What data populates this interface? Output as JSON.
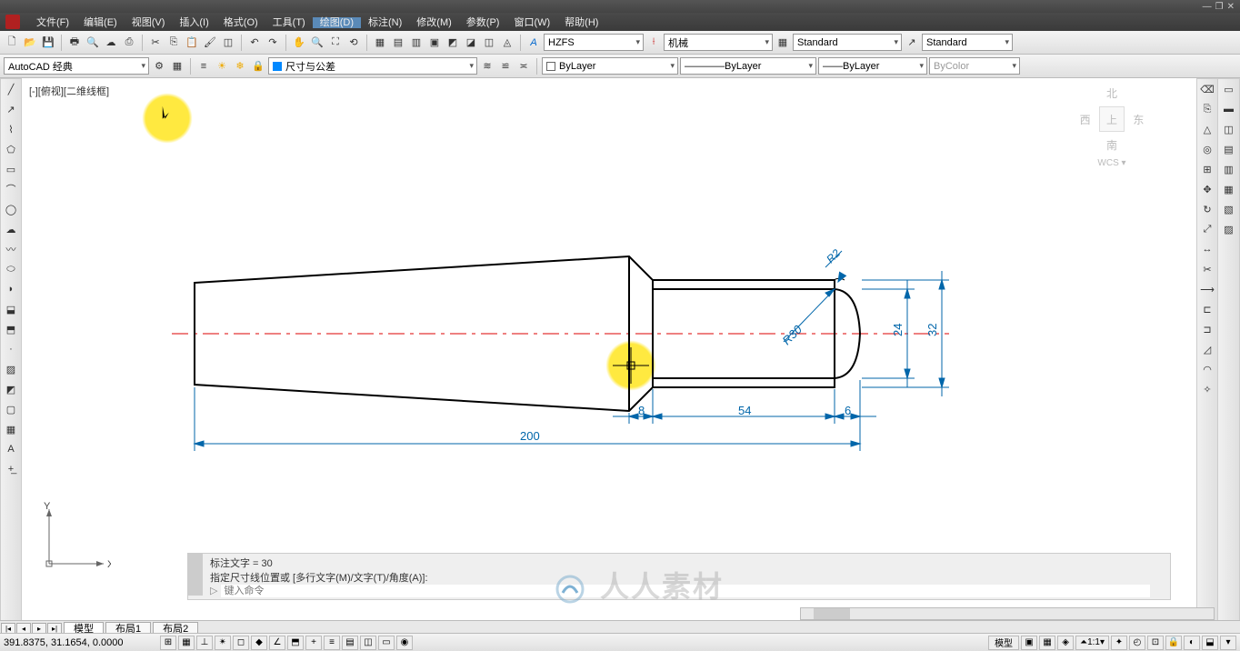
{
  "window": {
    "min": "—",
    "restore": "❐",
    "close": "✕"
  },
  "menu": [
    "文件(F)",
    "编辑(E)",
    "视图(V)",
    "插入(I)",
    "格式(O)",
    "工具(T)",
    "绘图(D)",
    "标注(N)",
    "修改(M)",
    "参数(P)",
    "窗口(W)",
    "帮助(H)"
  ],
  "menu_active_index": 6,
  "toolbar_combos": {
    "workspace": "AutoCAD 经典",
    "textstyle": "HZFS",
    "dimstyle": "机械",
    "std1": "Standard",
    "std2": "Standard",
    "layer_combo": "尺寸与公差",
    "bylayer1": "ByLayer",
    "bylayer2": "ByLayer",
    "bylayer3": "ByLayer",
    "bycolor": "ByColor"
  },
  "viewport": {
    "label": "[-][俯视][二维线框]"
  },
  "viewcube": {
    "n": "北",
    "w": "西",
    "top": "上",
    "e": "东",
    "s": "南",
    "wcs": "WCS ▾"
  },
  "drawing": {
    "dims": {
      "d200": "200",
      "d54": "54",
      "d8": "8",
      "d6": "6",
      "d24": "24",
      "d32": "32",
      "r30": "R30",
      "r2": "R2"
    }
  },
  "ucs": {
    "x": "X",
    "y": "Y"
  },
  "cmd": {
    "line1": "标注文字 = 30",
    "line2": "指定尺寸线位置或 [多行文字(M)/文字(T)/角度(A)]:",
    "placeholder": "键入命令"
  },
  "tabs": {
    "model": "模型",
    "layout1": "布局1",
    "layout2": "布局2"
  },
  "status": {
    "coords": "391.8375, 31.1654, 0.0000",
    "model": "模型",
    "scale": "1:1"
  },
  "watermark": "人人素材"
}
